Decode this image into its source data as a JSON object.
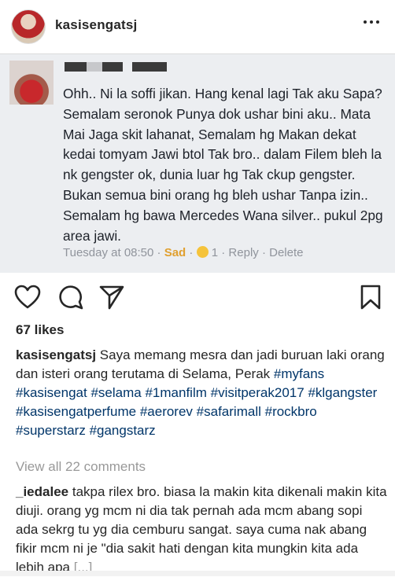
{
  "header": {
    "username": "kasisengatsj"
  },
  "fb_post": {
    "text": "Ohh.. Ni la soffi jikan. Hang kenal lagi Tak aku Sapa? Semalam seronok Punya dok ushar bini aku.. Mata Mai Jaga skit lahanat, Semalam hg Makan dekat kedai tomyam Jawi btol Tak bro.. dalam Filem bleh la nk gengster ok, dunia luar hg Tak ckup gengster. Bukan semua bini orang hg bleh ushar Tanpa izin.. Semalam hg bawa Mercedes Wana silver.. pukul 2pg area jawi.",
    "time": "Tuesday at 08:50",
    "sep1": "·",
    "reaction": "Sad",
    "sep2": "·",
    "count": "1",
    "sep3": "·",
    "reply": "Reply",
    "sep4": "·",
    "delete": "Delete"
  },
  "likes": "67 likes",
  "caption": {
    "user": "kasisengatsj",
    "text": "Saya memang mesra dan jadi buruan laki orang dan isteri orang terutama di Selama, Perak",
    "tags": [
      "#myfans",
      "#kasisengat",
      "#selama",
      "#1manfilm",
      "#visitperak2017",
      "#klgangster",
      "#kasisengatperfume",
      "#aerorev",
      "#safarimall",
      "#rockbro",
      "#superstarz",
      "#gangstarz"
    ]
  },
  "view_all": "View all 22 comments",
  "comment": {
    "user": "_iedalee",
    "text": "takpa rilex bro. biasa la makin kita dikenali makin kita diuji. orang yg mcm ni dia tak pernah ada mcm abang sopi ada sekrg tu yg dia cemburu sangat. saya cuma nak abang fikir mcm ni je \"dia sakit hati dengan kita mungkin kita ada lebih apa",
    "more": "[...]"
  },
  "icons": [
    "heart-icon",
    "comment-icon",
    "share-icon",
    "bookmark-icon",
    "more-icon"
  ],
  "colors": {
    "hashtag": "#003569",
    "meta": "#90949c",
    "card_bg": "#eceef1"
  }
}
